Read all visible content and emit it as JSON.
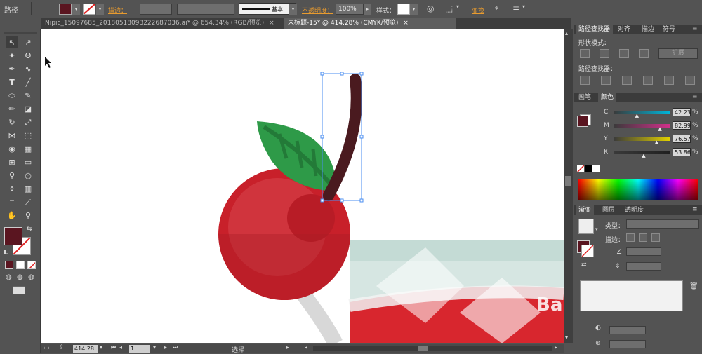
{
  "control_bar": {
    "object_type": "路径",
    "stroke_label": "描边：",
    "style_preset": "基本",
    "opacity_label": "不透明度：",
    "opacity_value": "100%",
    "style_label": "样式：",
    "transform_label": "变换"
  },
  "doc_tabs": [
    {
      "label": "Nipic_15097685_20180518093222687036.ai* @ 654.34% (RGB/预览)",
      "active": false
    },
    {
      "label": "未标题-15* @ 414.28% (CMYK/预览)",
      "active": true
    }
  ],
  "status_bar": {
    "zoom": "414.28",
    "page": "1",
    "tool_status": "选择"
  },
  "pathfinder_panel": {
    "tabs": [
      "路径查找器",
      "对齐",
      "描边",
      "符号"
    ],
    "shape_modes_label": "形状模式：",
    "expand_button": "扩展",
    "pathfinders_label": "路径查找器："
  },
  "color_panel": {
    "tabs": [
      "画笔",
      "颜色"
    ],
    "channels": [
      {
        "name": "C",
        "value": "42.23",
        "unit": "%",
        "fraction": 0.42,
        "color": "#00b4d8"
      },
      {
        "name": "M",
        "value": "82.99",
        "unit": "%",
        "fraction": 0.83,
        "color": "#d0308a"
      },
      {
        "name": "Y",
        "value": "76.57",
        "unit": "%",
        "fraction": 0.77,
        "color": "#e0d000"
      },
      {
        "name": "K",
        "value": "53.86",
        "unit": "%",
        "fraction": 0.54,
        "color": "#202020"
      }
    ]
  },
  "gradient_panel": {
    "tabs": [
      "渐变",
      "图层",
      "透明度"
    ],
    "type_label": "类型：",
    "stroke_label": "描边："
  },
  "colors": {
    "fill": "#5a1520",
    "cherry": "#c8202a",
    "leaf": "#2e9a48",
    "stem": "#4a1a1f",
    "glass": "#d6e6e2",
    "accent_orange": "#e89b2f"
  },
  "watermark": "Bai jing"
}
